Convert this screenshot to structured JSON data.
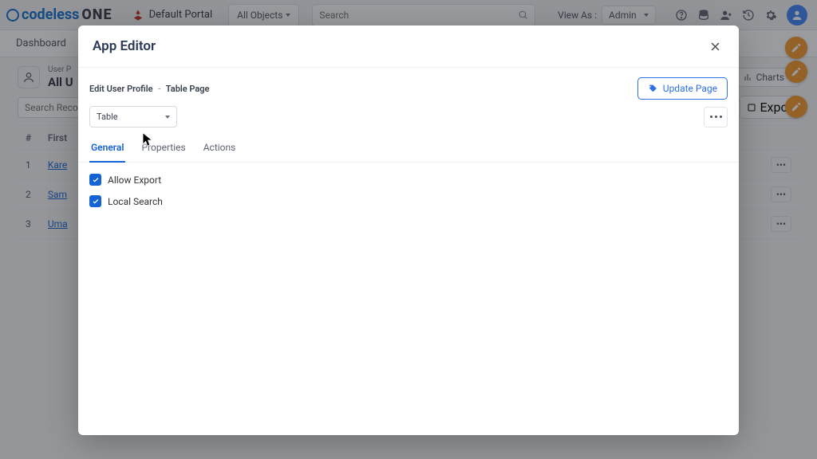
{
  "brand": {
    "p1": "codeless",
    "p2": "ONE"
  },
  "topbar": {
    "portal": "Default Portal",
    "objects_dd": "All Objects",
    "search_placeholder": "Search",
    "viewas_label": "View As :",
    "viewas_value": "Admin"
  },
  "secondbar": {
    "dashboard": "Dashboard"
  },
  "page": {
    "super": "User P",
    "title": "All U",
    "charts": "Charts",
    "export": "Expor",
    "search_placeholder": "Search Record"
  },
  "table": {
    "cols": {
      "idx": "#",
      "first": "First"
    },
    "rows": [
      {
        "n": "1",
        "name": "Kare"
      },
      {
        "n": "2",
        "name": "Sam"
      },
      {
        "n": "3",
        "name": "Uma"
      }
    ]
  },
  "modal": {
    "title": "App Editor",
    "crumb": {
      "a": "Edit",
      "b": "User Profile",
      "c": "Table",
      "d": "Page"
    },
    "update_btn": "Update Page",
    "select_value": "Table",
    "tabs": {
      "general": "General",
      "properties": "Properties",
      "actions": "Actions"
    },
    "opts": {
      "allow_export": "Allow Export",
      "local_search": "Local Search"
    }
  }
}
